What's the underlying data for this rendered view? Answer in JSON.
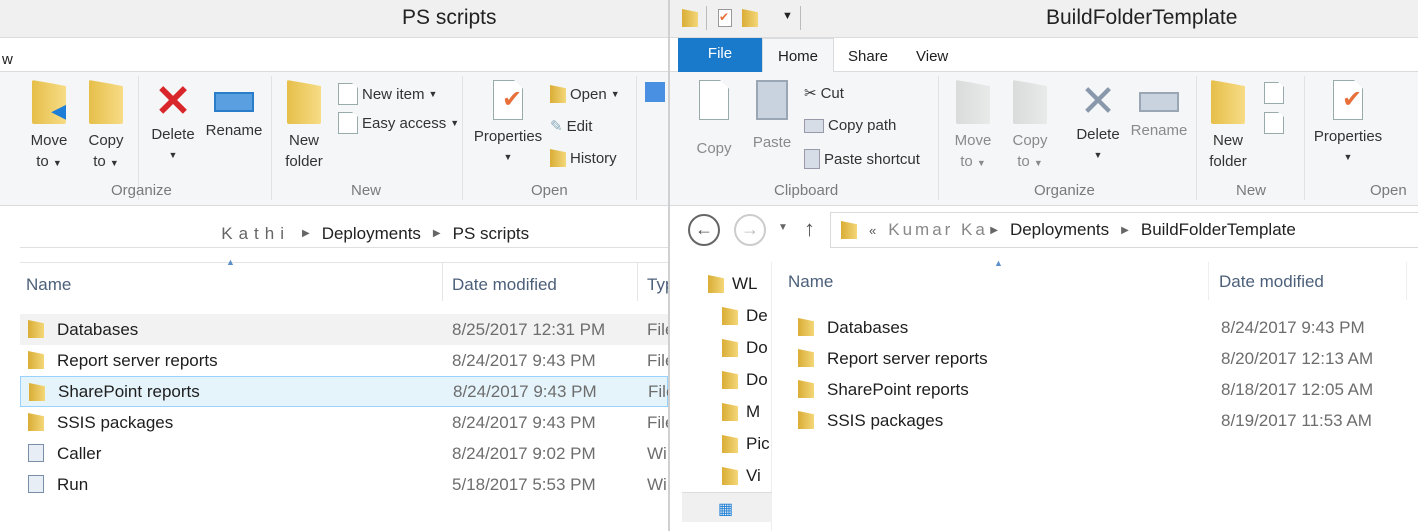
{
  "left_window": {
    "title": "PS scripts",
    "tab_fragment": "w",
    "ribbon": {
      "organize": {
        "label": "Organize",
        "move_to": [
          "Move",
          "to"
        ],
        "copy_to": [
          "Copy",
          "to"
        ],
        "delete": "Delete",
        "rename": "Rename"
      },
      "new": {
        "label": "New",
        "new_folder": [
          "New",
          "folder"
        ],
        "new_item": "New item",
        "easy_access": "Easy access"
      },
      "open": {
        "label": "Open",
        "properties": "Properties",
        "open": "Open",
        "edit": "Edit",
        "history": "History"
      }
    },
    "address": {
      "obscured": "Kathi",
      "crumbs": [
        "Deployments",
        "PS scripts"
      ]
    },
    "columns": {
      "name": "Name",
      "date": "Date modified",
      "type": "Typ"
    },
    "rows": [
      {
        "name": "Databases",
        "date": "8/25/2017 12:31 PM",
        "type": "File",
        "icon": "folder"
      },
      {
        "name": "Report server reports",
        "date": "8/24/2017 9:43 PM",
        "type": "File",
        "icon": "folder"
      },
      {
        "name": "SharePoint reports",
        "date": "8/24/2017 9:43 PM",
        "type": "File",
        "icon": "folder"
      },
      {
        "name": "SSIS packages",
        "date": "8/24/2017 9:43 PM",
        "type": "File",
        "icon": "folder"
      },
      {
        "name": "Caller",
        "date": "8/24/2017 9:02 PM",
        "type": "Wi",
        "icon": "script"
      },
      {
        "name": "Run",
        "date": "5/18/2017 5:53 PM",
        "type": "Wi",
        "icon": "script"
      }
    ]
  },
  "right_window": {
    "title": "BuildFolderTemplate",
    "tabs": [
      "File",
      "Home",
      "Share",
      "View"
    ],
    "ribbon": {
      "clipboard": {
        "label": "Clipboard",
        "copy": "Copy",
        "paste": "Paste",
        "cut": "Cut",
        "copy_path": "Copy path",
        "paste_shortcut": "Paste shortcut"
      },
      "organize": {
        "label": "Organize",
        "move_to": [
          "Move",
          "to"
        ],
        "copy_to": [
          "Copy",
          "to"
        ],
        "delete": "Delete",
        "rename": "Rename"
      },
      "new": {
        "label": "New",
        "new_folder": [
          "New",
          "folder"
        ]
      },
      "open": {
        "label": "Open",
        "properties": "Properties"
      }
    },
    "address": {
      "prefix": "«",
      "obscured": "Kumar Ka",
      "crumbs": [
        "Deployments",
        "BuildFolderTemplate"
      ]
    },
    "nav_pane": [
      "WL",
      "De",
      "Do",
      "Do",
      "M",
      "Pic",
      "Vi"
    ],
    "columns": {
      "name": "Name",
      "date": "Date modified"
    },
    "rows": [
      {
        "name": "Databases",
        "date": "8/24/2017 9:43 PM"
      },
      {
        "name": "Report server reports",
        "date": "8/20/2017 12:13 AM"
      },
      {
        "name": "SharePoint reports",
        "date": "8/18/2017 12:05 AM"
      },
      {
        "name": "SSIS packages",
        "date": "8/19/2017 11:53 AM"
      }
    ]
  },
  "colors": {
    "file_tab": "#1979ca",
    "selected_row": "#e5f3fb",
    "selected_border": "#99d1ff",
    "delete_red": "#d9262b"
  }
}
